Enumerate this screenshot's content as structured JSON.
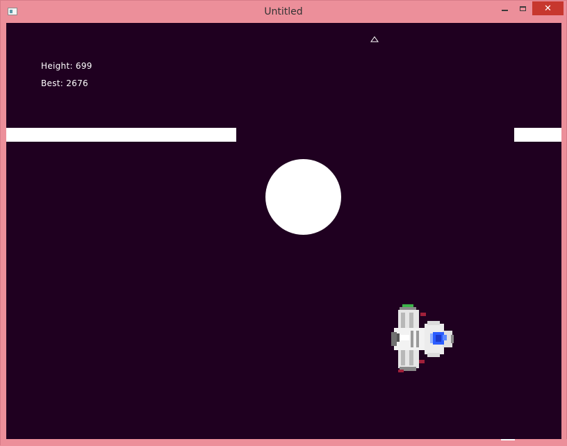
{
  "window": {
    "title": "Untitled",
    "close_symbol": "✕"
  },
  "hud": {
    "height_text": "Height: 699",
    "best_text": "Best: 2676"
  },
  "icons": {
    "app": "app-window-icon",
    "minimize": "minimize-icon",
    "maximize": "maximize-icon",
    "close": "close-icon",
    "up_indicator": "up-arrow-icon",
    "player": "spaceship-icon"
  },
  "colors": {
    "background": "#1f0020",
    "platform": "#ffffff",
    "ball": "#ffffff",
    "titlebar": "#ec8f9a",
    "close_button": "#c7372e",
    "ship_body": "#e8e8e8",
    "ship_cockpit": "#2a5cff"
  }
}
